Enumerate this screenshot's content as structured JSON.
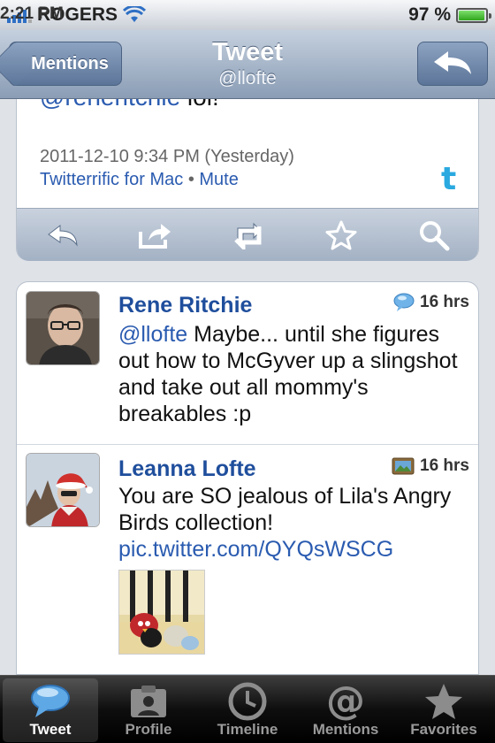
{
  "status_bar": {
    "carrier": "ROGERS",
    "time": "2:21 PM",
    "battery": "97 %",
    "battery_level": 0.97
  },
  "nav": {
    "back_label": "Mentions",
    "title": "Tweet",
    "subtitle": "@llofte"
  },
  "tweet": {
    "cut_mention": "@reneritchie",
    "cut_text": " lol!",
    "timestamp": "2011-12-10 9:34 PM (Yesterday)",
    "client": "Twitterrific for Mac",
    "separator": "•",
    "mute": "Mute"
  },
  "actions": [
    "reply-icon",
    "share-icon",
    "retweet-icon",
    "favorite-icon",
    "search-icon"
  ],
  "list": [
    {
      "name": "Rene Ritchie",
      "time": "16 hrs",
      "mention": "@llofte",
      "text": " Maybe... until she figures out how to McGyver up a slingshot and take out all mommy's breakables :p"
    },
    {
      "name": "Leanna Lofte",
      "time": "16 hrs",
      "text": "You are SO jealous of Lila's Angry Birds collection!",
      "link": "pic.twitter.com/QYQsWSCG"
    }
  ],
  "tabs": [
    {
      "label": "Tweet",
      "icon": "speech-bubble-icon",
      "active": true
    },
    {
      "label": "Profile",
      "icon": "profile-icon"
    },
    {
      "label": "Timeline",
      "icon": "clock-icon"
    },
    {
      "label": "Mentions",
      "icon": "at-icon"
    },
    {
      "label": "Favorites",
      "icon": "star-icon"
    }
  ]
}
